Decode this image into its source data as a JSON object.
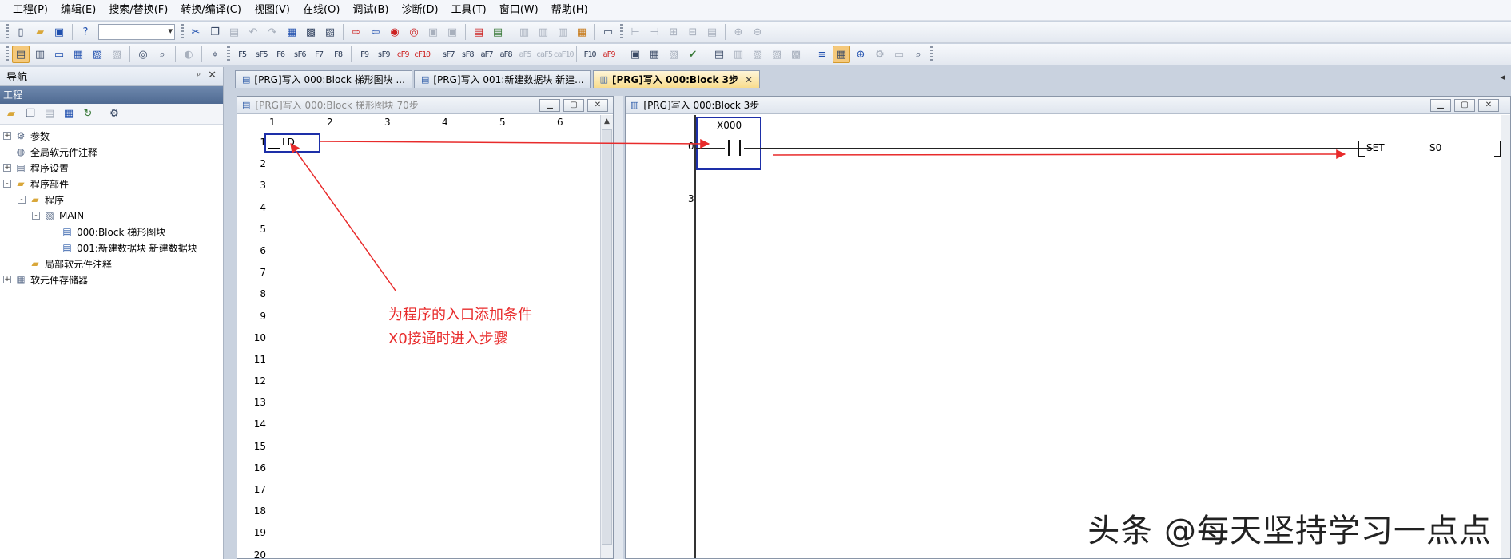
{
  "menu": [
    {
      "label": "工程(P)"
    },
    {
      "label": "编辑(E)"
    },
    {
      "label": "搜索/替换(F)"
    },
    {
      "label": "转换/编译(C)"
    },
    {
      "label": "视图(V)"
    },
    {
      "label": "在线(O)"
    },
    {
      "label": "调试(B)"
    },
    {
      "label": "诊断(D)"
    },
    {
      "label": "工具(T)"
    },
    {
      "label": "窗口(W)"
    },
    {
      "label": "帮助(H)"
    }
  ],
  "toolbar2": {
    "ladder_keys": [
      "F5",
      "sF5",
      "F6",
      "sF6",
      "F7",
      "F8",
      "F9",
      "sF9",
      "cF9",
      "cF10",
      "sF7",
      "sF8",
      "aF7",
      "aF8",
      "aF5",
      "caF5",
      "caF10",
      "F10",
      "aF9"
    ]
  },
  "nav": {
    "title": "导航",
    "pin_glyph": "ᵖ",
    "close_glyph": "✕",
    "section": "工程",
    "tree": [
      {
        "label": "参数",
        "level": 0,
        "expander": "+",
        "icon": "gear-icon"
      },
      {
        "label": "全局软元件注释",
        "level": 0,
        "expander": "",
        "icon": "globe-icon"
      },
      {
        "label": "程序设置",
        "level": 0,
        "expander": "+",
        "icon": "settings-icon"
      },
      {
        "label": "程序部件",
        "level": 0,
        "expander": "-",
        "icon": "folder-icon"
      },
      {
        "label": "程序",
        "level": 1,
        "expander": "-",
        "icon": "folder-icon"
      },
      {
        "label": "MAIN",
        "level": 2,
        "expander": "-",
        "icon": "program-icon"
      },
      {
        "label": "000:Block 梯形图块",
        "level": 3,
        "expander": "",
        "icon": "document-icon"
      },
      {
        "label": "001:新建数据块 新建数据块",
        "level": 3,
        "expander": "",
        "icon": "document-icon"
      },
      {
        "label": "局部软元件注释",
        "level": 1,
        "expander": "",
        "icon": "folder-icon"
      },
      {
        "label": "软元件存储器",
        "level": 0,
        "expander": "+",
        "icon": "database-icon"
      }
    ]
  },
  "tabs": [
    {
      "label": "[PRG]写入 000:Block 梯形图块 ...",
      "active": false
    },
    {
      "label": "[PRG]写入 001:新建数据块 新建...",
      "active": false
    },
    {
      "label": "[PRG]写入 000:Block 3步",
      "active": true
    }
  ],
  "tab_close_glyph": "✕",
  "tab_nav_glyph": "◂",
  "list_window": {
    "title": "[PRG]写入 000:Block 梯形图块 70步",
    "columns": [
      "1",
      "2",
      "3",
      "4",
      "5",
      "6"
    ],
    "rows": [
      "1",
      "2",
      "3",
      "4",
      "5",
      "6",
      "7",
      "8",
      "9",
      "10",
      "11",
      "12",
      "13",
      "14",
      "15",
      "16",
      "17",
      "18",
      "19",
      "20"
    ],
    "cell_text": "LD"
  },
  "ladder_window": {
    "title": "[PRG]写入 000:Block 3步",
    "contact_device": "X000",
    "rung_step": "0",
    "end_step": "3",
    "coil_instr": "SET",
    "coil_device": "S0"
  },
  "window_buttons": {
    "minimize": "▁",
    "restore": "▢",
    "close": "✕"
  },
  "annotation": {
    "line1": "为程序的入口添加条件",
    "line2": "X0接通时进入步骤",
    "color": "#e82b2b"
  },
  "watermark": "头条 @每天坚持学习一点点"
}
